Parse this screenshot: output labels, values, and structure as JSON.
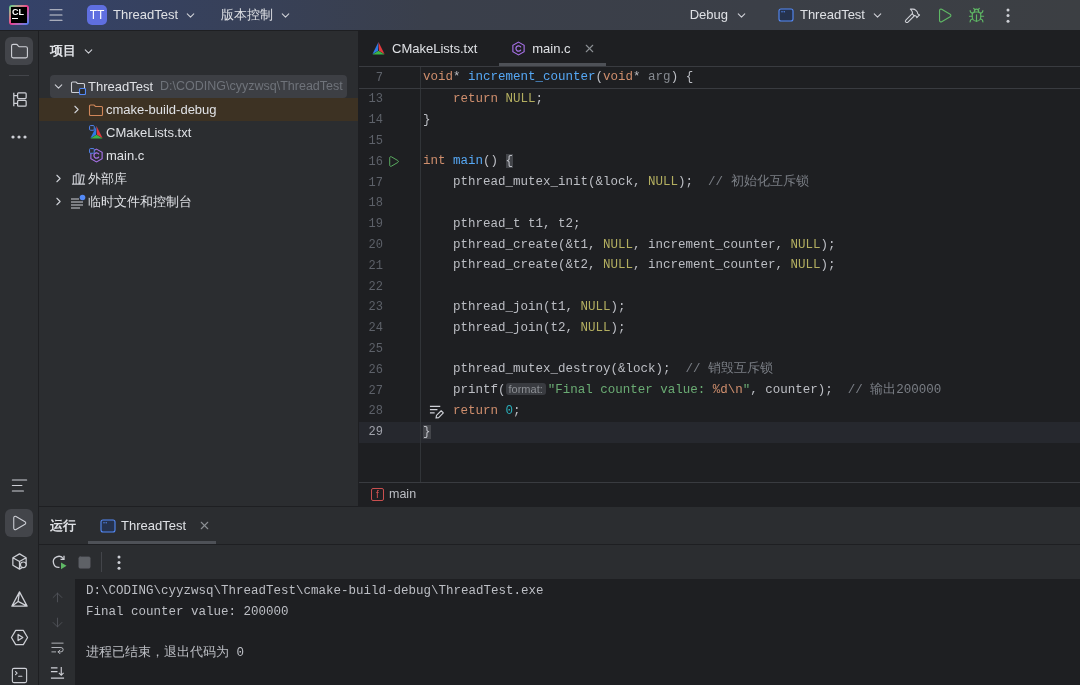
{
  "title_bar": {
    "logo": "CL",
    "project": {
      "initials": "TT",
      "name": "ThreadTest"
    },
    "vcs": "版本控制",
    "configuration": "Debug",
    "run_target": "ThreadTest"
  },
  "left_toolbar": {
    "top": [
      {
        "kind": "project",
        "selected": true
      },
      {
        "kind": "structure",
        "selected": false
      },
      {
        "kind": "more",
        "selected": false
      }
    ],
    "bottom": [
      {
        "kind": "lines",
        "selected": false
      },
      {
        "kind": "run",
        "selected": true
      },
      {
        "kind": "packages",
        "selected": false
      },
      {
        "kind": "cmake",
        "selected": false
      },
      {
        "kind": "services",
        "selected": false
      },
      {
        "kind": "terminal",
        "selected": false
      }
    ]
  },
  "project_panel": {
    "title": "项目",
    "tree": [
      {
        "kind": "module",
        "label": "ThreadTest",
        "path": "D:\\CODING\\cyyzwsq\\ThreadTest",
        "expanded": true,
        "selected": true,
        "excluded": false,
        "children": [
          {
            "kind": "folder",
            "label": "cmake-build-debug",
            "expanded": false,
            "selected": false,
            "excluded": true
          },
          {
            "kind": "cmake",
            "label": "CMakeLists.txt",
            "selected": false,
            "excluded": false
          },
          {
            "kind": "c",
            "label": "main.c",
            "selected": false,
            "excluded": false
          }
        ]
      },
      {
        "kind": "library",
        "label": "外部库",
        "expanded": false,
        "selected": false,
        "excluded": false
      },
      {
        "kind": "scratches",
        "label": "临时文件和控制台",
        "expanded": false,
        "selected": false,
        "excluded": false
      }
    ]
  },
  "editor": {
    "tabs": [
      {
        "kind": "cmake",
        "label": "CMakeLists.txt",
        "selected": false
      },
      {
        "kind": "c",
        "label": "main.c",
        "selected": true
      }
    ],
    "sticky_line": {
      "number": "7",
      "tokens": [
        {
          "kind": "keyword",
          "text": "void"
        },
        {
          "kind": "plain",
          "text": "* "
        },
        {
          "kind": "function",
          "text": "increment_counter"
        },
        {
          "kind": "plain",
          "text": "("
        },
        {
          "kind": "keyword",
          "text": "void"
        },
        {
          "kind": "plain",
          "text": "* "
        },
        {
          "kind": "param",
          "text": "arg"
        },
        {
          "kind": "plain",
          "text": ") {"
        }
      ]
    },
    "lines": [
      {
        "kind": "code",
        "number": "13",
        "indented": true,
        "current": false,
        "tokens": [
          {
            "kind": "keyword",
            "text": "return "
          },
          {
            "kind": "macro",
            "text": "NULL"
          },
          {
            "kind": "plain",
            "text": ";"
          }
        ]
      },
      {
        "kind": "code",
        "number": "14",
        "indented": false,
        "current": false,
        "tokens": [
          {
            "kind": "plain",
            "text": "}"
          }
        ]
      },
      {
        "kind": "code",
        "number": "15",
        "current": false
      },
      {
        "kind": "run",
        "number": "16",
        "indented": false,
        "current": false,
        "tokens": [
          {
            "kind": "keyword",
            "text": "int "
          },
          {
            "kind": "function",
            "text": "main"
          },
          {
            "kind": "plain",
            "text": "() "
          },
          {
            "kind": "brace",
            "text": "{"
          }
        ]
      },
      {
        "kind": "code",
        "number": "17",
        "indented": true,
        "current": false,
        "tokens": [
          {
            "kind": "plain",
            "text": "pthread_mutex_init(&lock, "
          },
          {
            "kind": "macro",
            "text": "NULL"
          },
          {
            "kind": "plain",
            "text": ");  "
          },
          {
            "kind": "comment",
            "text": "// 初始化互斥锁"
          }
        ]
      },
      {
        "kind": "code",
        "number": "18",
        "current": false
      },
      {
        "kind": "code",
        "number": "19",
        "indented": true,
        "current": false,
        "tokens": [
          {
            "kind": "plain",
            "text": "pthread_t t1, t2;"
          }
        ]
      },
      {
        "kind": "code",
        "number": "20",
        "indented": true,
        "current": false,
        "tokens": [
          {
            "kind": "plain",
            "text": "pthread_create(&t1, "
          },
          {
            "kind": "macro",
            "text": "NULL"
          },
          {
            "kind": "plain",
            "text": ", increment_counter, "
          },
          {
            "kind": "macro",
            "text": "NULL"
          },
          {
            "kind": "plain",
            "text": ");"
          }
        ]
      },
      {
        "kind": "code",
        "number": "21",
        "indented": true,
        "current": false,
        "tokens": [
          {
            "kind": "plain",
            "text": "pthread_create(&t2, "
          },
          {
            "kind": "macro",
            "text": "NULL"
          },
          {
            "kind": "plain",
            "text": ", increment_counter, "
          },
          {
            "kind": "macro",
            "text": "NULL"
          },
          {
            "kind": "plain",
            "text": ");"
          }
        ]
      },
      {
        "kind": "code",
        "number": "22",
        "current": false
      },
      {
        "kind": "code",
        "number": "23",
        "indented": true,
        "current": false,
        "tokens": [
          {
            "kind": "plain",
            "text": "pthread_join(t1, "
          },
          {
            "kind": "macro",
            "text": "NULL"
          },
          {
            "kind": "plain",
            "text": ");"
          }
        ]
      },
      {
        "kind": "code",
        "number": "24",
        "indented": true,
        "current": false,
        "tokens": [
          {
            "kind": "plain",
            "text": "pthread_join(t2, "
          },
          {
            "kind": "macro",
            "text": "NULL"
          },
          {
            "kind": "plain",
            "text": ");"
          }
        ]
      },
      {
        "kind": "code",
        "number": "25",
        "current": false
      },
      {
        "kind": "code",
        "number": "26",
        "indented": true,
        "current": false,
        "tokens": [
          {
            "kind": "plain",
            "text": "pthread_mutex_destroy(&lock);  "
          },
          {
            "kind": "comment",
            "text": "// 销毁互斥锁"
          }
        ]
      },
      {
        "kind": "code",
        "number": "27",
        "indented": true,
        "current": false,
        "tokens": [
          {
            "kind": "plain",
            "text": "printf("
          },
          {
            "kind": "hint",
            "text": "format:"
          },
          {
            "kind": "string",
            "text": "\"Final counter value: "
          },
          {
            "kind": "escape",
            "text": "%d\\n"
          },
          {
            "kind": "string",
            "text": "\""
          },
          {
            "kind": "plain",
            "text": ", counter);  "
          },
          {
            "kind": "comment",
            "text": "// 输出200000"
          }
        ]
      },
      {
        "kind": "edit",
        "number": "28",
        "indented": true,
        "current": false,
        "tokens": [
          {
            "kind": "keyword",
            "text": "return "
          },
          {
            "kind": "number",
            "text": "0"
          },
          {
            "kind": "plain",
            "text": ";"
          }
        ]
      },
      {
        "kind": "code",
        "number": "29",
        "indented": false,
        "current": true,
        "tokens": [
          {
            "kind": "brace",
            "text": "}"
          }
        ]
      }
    ],
    "breadcrumb": {
      "symbol": "f",
      "label": "main"
    }
  },
  "run_panel": {
    "title": "运行",
    "tabs": [
      {
        "label": "ThreadTest",
        "selected": true
      }
    ],
    "toolbar": [
      {
        "kind": "rerun",
        "disabled": false
      },
      {
        "kind": "stop",
        "disabled": true
      },
      {
        "kind": "more",
        "disabled": false
      }
    ],
    "gutter": [
      {
        "kind": "up",
        "disabled": true
      },
      {
        "kind": "down",
        "disabled": true
      },
      {
        "kind": "wrap",
        "disabled": false
      },
      {
        "kind": "scrollend",
        "disabled": false
      }
    ],
    "console": [
      {
        "kind": "command",
        "text": "D:\\CODING\\cyyzwsq\\ThreadTest\\cmake-build-debug\\ThreadTest.exe"
      },
      {
        "kind": "output",
        "text": "Final counter value: 200000"
      },
      {
        "kind": "exit",
        "text": "进程已结束，退出代码为 0"
      }
    ]
  }
}
